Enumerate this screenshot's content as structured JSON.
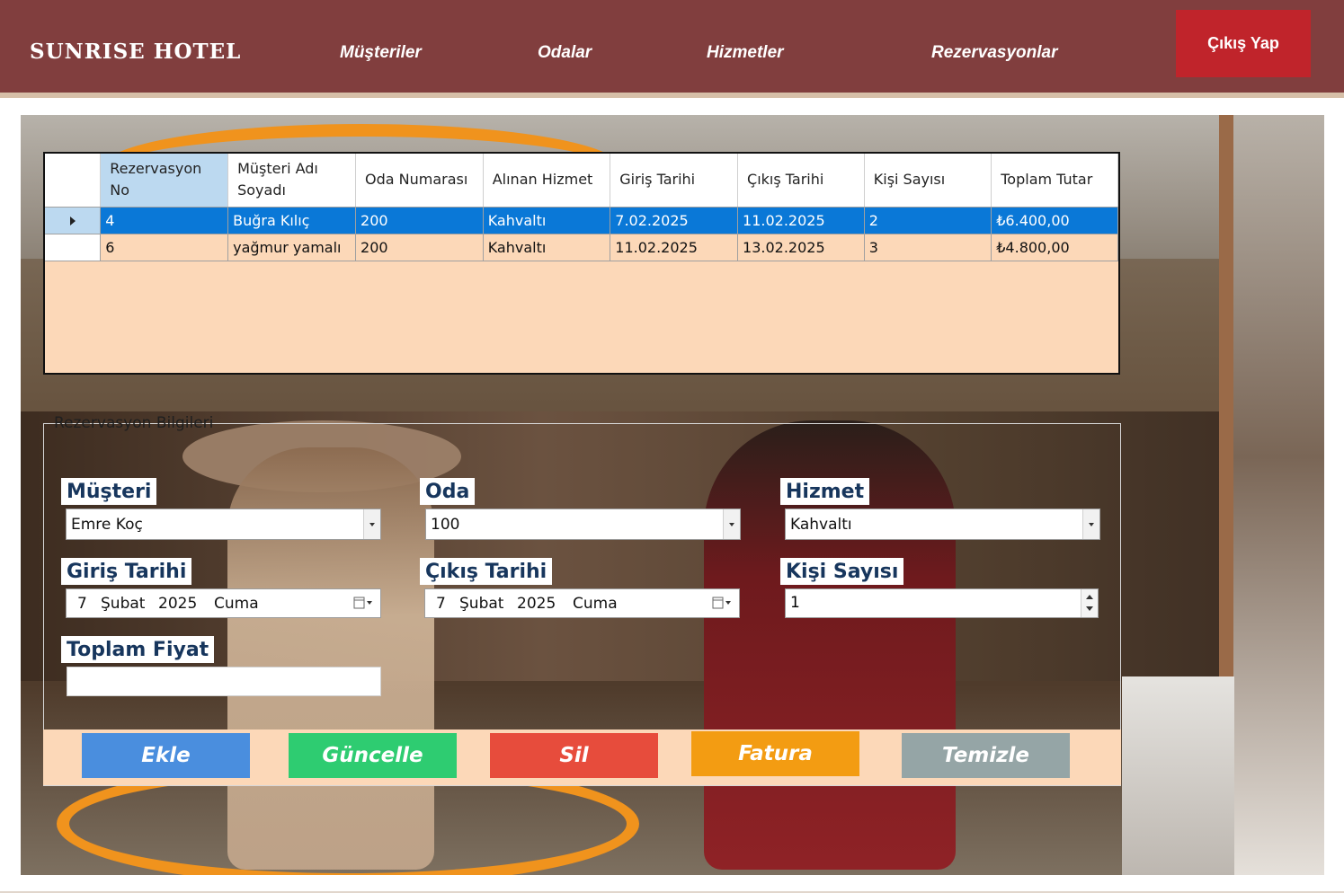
{
  "header": {
    "brand": "SUNRISE HOTEL",
    "nav": [
      "Müşteriler",
      "Odalar",
      "Hizmetler",
      "Rezervasyonlar"
    ],
    "logout_label": "Çıkış Yap",
    "bg_color": "#813e3e",
    "logout_color": "#c0242b"
  },
  "grid": {
    "columns": [
      "Rezervasyon No",
      "Müşteri Adı Soyadı",
      "Oda Numarası",
      "Alınan Hizmet",
      "Giriş Tarihi",
      "Çıkış Tarihi",
      "Kişi Sayısı",
      "Toplam Tutar"
    ],
    "rows": [
      [
        "4",
        "Buğra Kılıç",
        "200",
        "Kahvaltı",
        "7.02.2025",
        "11.02.2025",
        "2",
        "₺6.400,00"
      ],
      [
        "6",
        "yağmur yamalı",
        "200",
        "Kahvaltı",
        "11.02.2025",
        "13.02.2025",
        "3",
        "₺4.800,00"
      ]
    ],
    "selected_row": 0
  },
  "form": {
    "group_title": "Rezervasyon Bilgileri",
    "musteri_label": "Müşteri",
    "musteri_value": "Emre Koç",
    "oda_label": "Oda",
    "oda_value": "100",
    "hizmet_label": "Hizmet",
    "hizmet_value": "Kahvaltı",
    "giris_label": "Giriş Tarihi",
    "giris_date": {
      "day": "7",
      "month": "Şubat",
      "year": "2025",
      "weekday": "Cuma"
    },
    "cikis_label": "Çıkış Tarihi",
    "cikis_date": {
      "day": "7",
      "month": "Şubat",
      "year": "2025",
      "weekday": "Cuma"
    },
    "kisi_label": "Kişi Sayısı",
    "kisi_value": "1",
    "toplam_label": "Toplam Fiyat",
    "toplam_value": ""
  },
  "buttons": {
    "ekle": "Ekle",
    "guncelle": "Güncelle",
    "sil": "Sil",
    "fatura": "Fatura",
    "temizle": "Temizle",
    "colors": {
      "ekle": "#4a8ede",
      "guncelle": "#2ecc71",
      "sil": "#e74c3c",
      "fatura": "#f39c12",
      "temizle": "#95a5a6"
    }
  }
}
